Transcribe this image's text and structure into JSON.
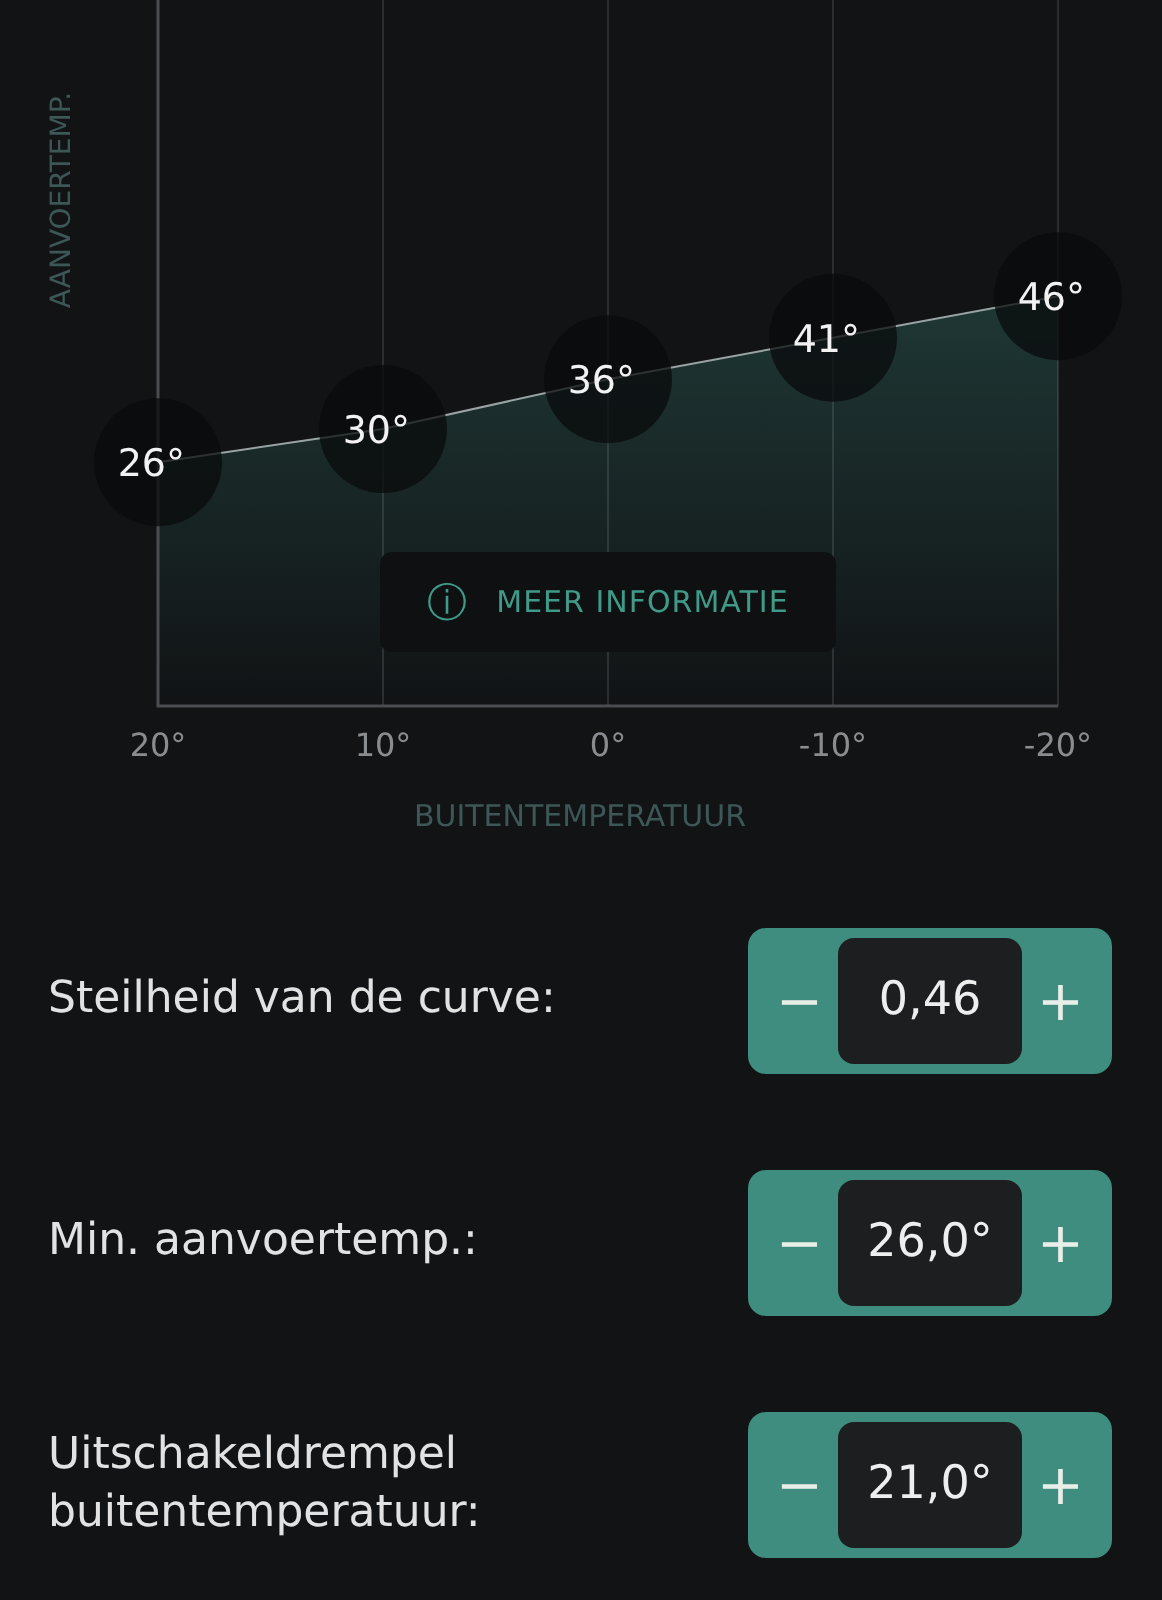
{
  "chart": {
    "button": {
      "icon": "ⓘ",
      "label": "MEER INFORMATIE"
    },
    "chart_data": {
      "type": "area",
      "xlabel": "BUITENTEMPERATUUR",
      "ylabel": "AANVOERTEMP.",
      "categories": [
        "20°",
        "10°",
        "0°",
        "-10°",
        "-20°"
      ],
      "series": [
        {
          "values": [
            26,
            30,
            36,
            41,
            46
          ]
        }
      ],
      "grid": true,
      "data_labels": true
    },
    "label_unit": "°"
  },
  "settings": [
    {
      "label": "Steilheid van de curve:",
      "minus": "−",
      "value": "0,46",
      "plus": "+"
    },
    {
      "label": "Min. aanvoertemp.:",
      "minus": "−",
      "value": "26,0°",
      "plus": "+"
    },
    {
      "label": "Uitschakeldrempel buitentemperatuur:",
      "minus": "−",
      "value": "21,0°",
      "plus": "+"
    }
  ]
}
